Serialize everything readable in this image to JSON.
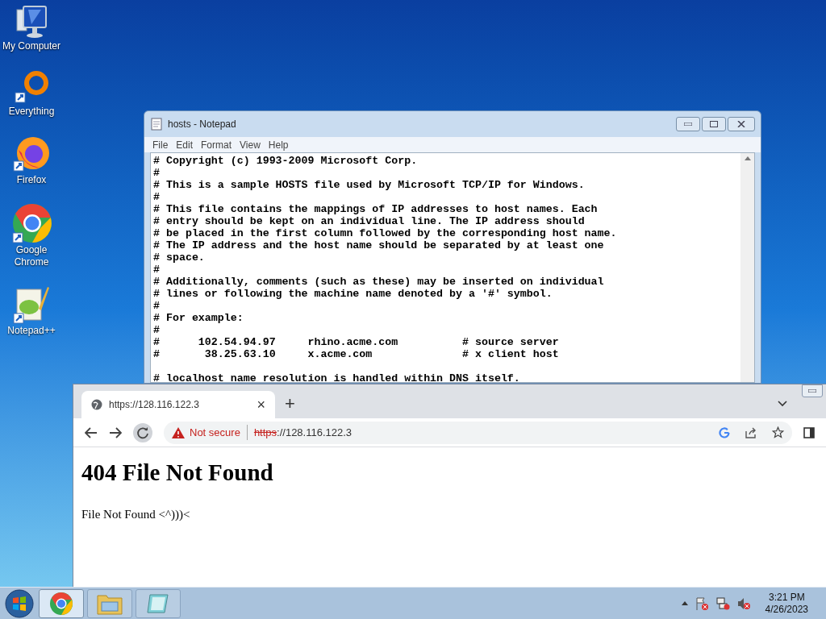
{
  "desktop_icons": [
    {
      "label": "My Computer",
      "kind": "computer"
    },
    {
      "label": "Everything",
      "kind": "everything"
    },
    {
      "label": "Firefox",
      "kind": "firefox"
    },
    {
      "label": "Google Chrome",
      "kind": "chrome"
    },
    {
      "label": "Notepad++",
      "kind": "notepadpp"
    }
  ],
  "notepad": {
    "title": "hosts - Notepad",
    "menu": [
      "File",
      "Edit",
      "Format",
      "View",
      "Help"
    ],
    "blank_before_last": true,
    "lines": [
      "# Copyright (c) 1993-2009 Microsoft Corp.",
      "#",
      "# This is a sample HOSTS file used by Microsoft TCP/IP for Windows.",
      "#",
      "# This file contains the mappings of IP addresses to host names. Each",
      "# entry should be kept on an individual line. The IP address should",
      "# be placed in the first column followed by the corresponding host name.",
      "# The IP address and the host name should be separated by at least one",
      "# space.",
      "#",
      "# Additionally, comments (such as these) may be inserted on individual",
      "# lines or following the machine name denoted by a '#' symbol.",
      "#",
      "# For example:",
      "#",
      "#      102.54.94.97     rhino.acme.com          # source server",
      "#       38.25.63.10     x.acme.com              # x client host",
      "# localhost name resolution is handled within DNS itself."
    ]
  },
  "browser": {
    "tabs": [
      {
        "title": "https://128.116.122.3",
        "selected": true
      }
    ],
    "tab_close": "×",
    "new_tab": "+",
    "security": "Not secure",
    "url_scheme": "https",
    "url_rest": "://128.116.122.3",
    "heading": "404 File Not Found",
    "body": "File Not Found <^)))<"
  },
  "taskbar": {
    "buttons": [
      {
        "kind": "chrome",
        "selected": true
      },
      {
        "kind": "explorer",
        "selected": false
      },
      {
        "kind": "notepad",
        "selected": false
      }
    ],
    "time": "3:21 PM",
    "date": "4/26/2023"
  }
}
